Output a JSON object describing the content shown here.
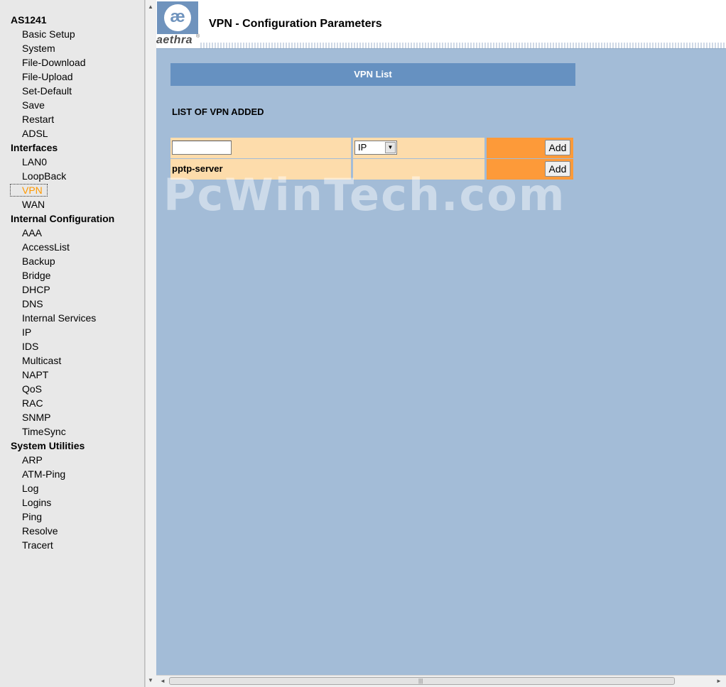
{
  "nav": {
    "sections": [
      {
        "title": "AS1241",
        "items": [
          "Basic Setup",
          "System",
          "File-Download",
          "File-Upload",
          "Set-Default",
          "Save",
          "Restart",
          "ADSL"
        ]
      },
      {
        "title": "Interfaces",
        "items": [
          "LAN0",
          "LoopBack",
          "VPN",
          "WAN"
        ]
      },
      {
        "title": "Internal Configuration",
        "items": [
          "AAA",
          "AccessList",
          "Backup",
          "Bridge",
          "DHCP",
          "DNS",
          "Internal Services",
          "IP",
          "IDS",
          "Multicast",
          "NAPT",
          "QoS",
          "RAC",
          "SNMP",
          "TimeSync"
        ]
      },
      {
        "title": "System Utilities",
        "items": [
          "ARP",
          "ATM-Ping",
          "Log",
          "Logins",
          "Ping",
          "Resolve",
          "Tracert"
        ]
      }
    ],
    "active_item": "VPN",
    "active_color": "#ff9900"
  },
  "header": {
    "logo_mark": "æ",
    "logo_text": "aethra",
    "logo_reg": "®",
    "title": "VPN - Configuration Parameters"
  },
  "main": {
    "section_bar": "VPN List",
    "list_heading": "LIST OF VPN ADDED",
    "new_row": {
      "name_value": "",
      "type_selected": "IP",
      "add_label": "Add"
    },
    "vpn_rows": [
      {
        "name": "pptp-server",
        "type": "",
        "add_label": "Add"
      }
    ]
  },
  "watermark": "PcWinTech.com",
  "colors": {
    "content_bg": "#a3bcd7",
    "bar_bg": "#6691c1",
    "cell_bg": "#fddcab",
    "action_bg": "#fd9a39",
    "nav_bg": "#e8e8e8"
  },
  "icons": {
    "scroll_up": "▲",
    "scroll_down": "▼",
    "scroll_left": "◄",
    "scroll_right": "►",
    "dropdown": "▼",
    "grip": "|||"
  }
}
